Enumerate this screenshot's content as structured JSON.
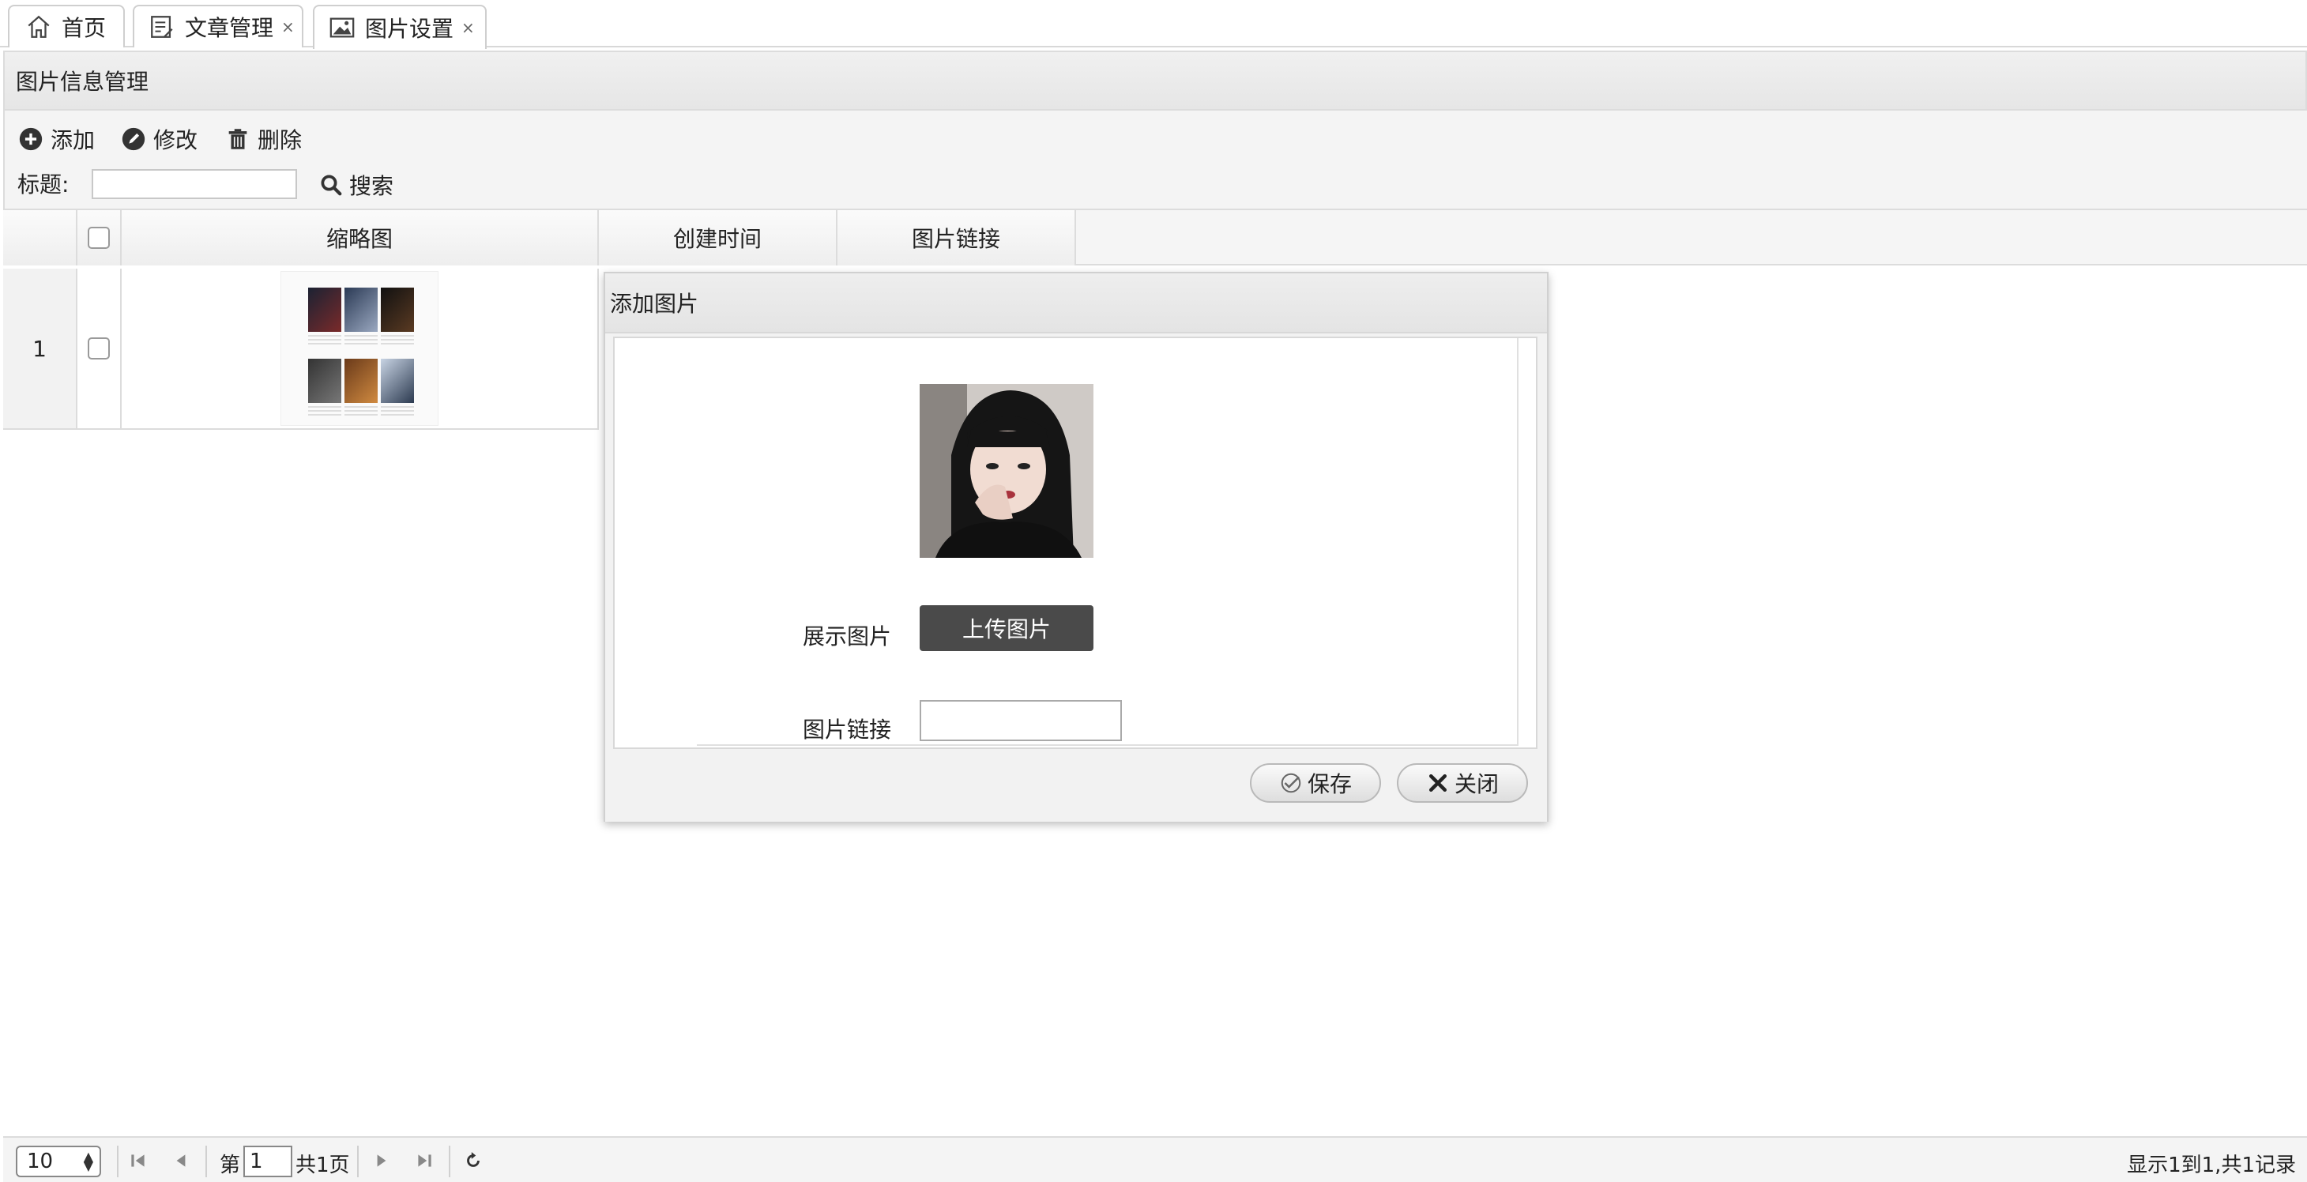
{
  "tabs": [
    {
      "label": "首页",
      "icon": "home-icon",
      "closable": false
    },
    {
      "label": "文章管理",
      "icon": "document-icon",
      "closable": true
    },
    {
      "label": "图片设置",
      "icon": "image-icon",
      "closable": true,
      "active": true
    }
  ],
  "tab_close_glyph": "×",
  "panel": {
    "title": "图片信息管理"
  },
  "toolbar": {
    "add_label": "添加",
    "edit_label": "修改",
    "delete_label": "删除",
    "search_label": "标题:",
    "search_value": "",
    "search_button": "搜索"
  },
  "grid": {
    "columns": [
      "缩略图",
      "创建时间",
      "图片链接"
    ],
    "rows": [
      {
        "index": "1",
        "thumbnail": "image-thumbnail",
        "created": "",
        "link": ""
      }
    ]
  },
  "dialog": {
    "title": "添加图片",
    "display_image_label": "展示图片",
    "upload_button": "上传图片",
    "link_label": "图片链接",
    "link_value": "",
    "save_button": "保存",
    "close_button": "关闭"
  },
  "pager": {
    "page_size": "10",
    "page_prefix": "第",
    "current_page": "1",
    "page_suffix": "共1页",
    "info": "显示1到1,共1记录"
  }
}
